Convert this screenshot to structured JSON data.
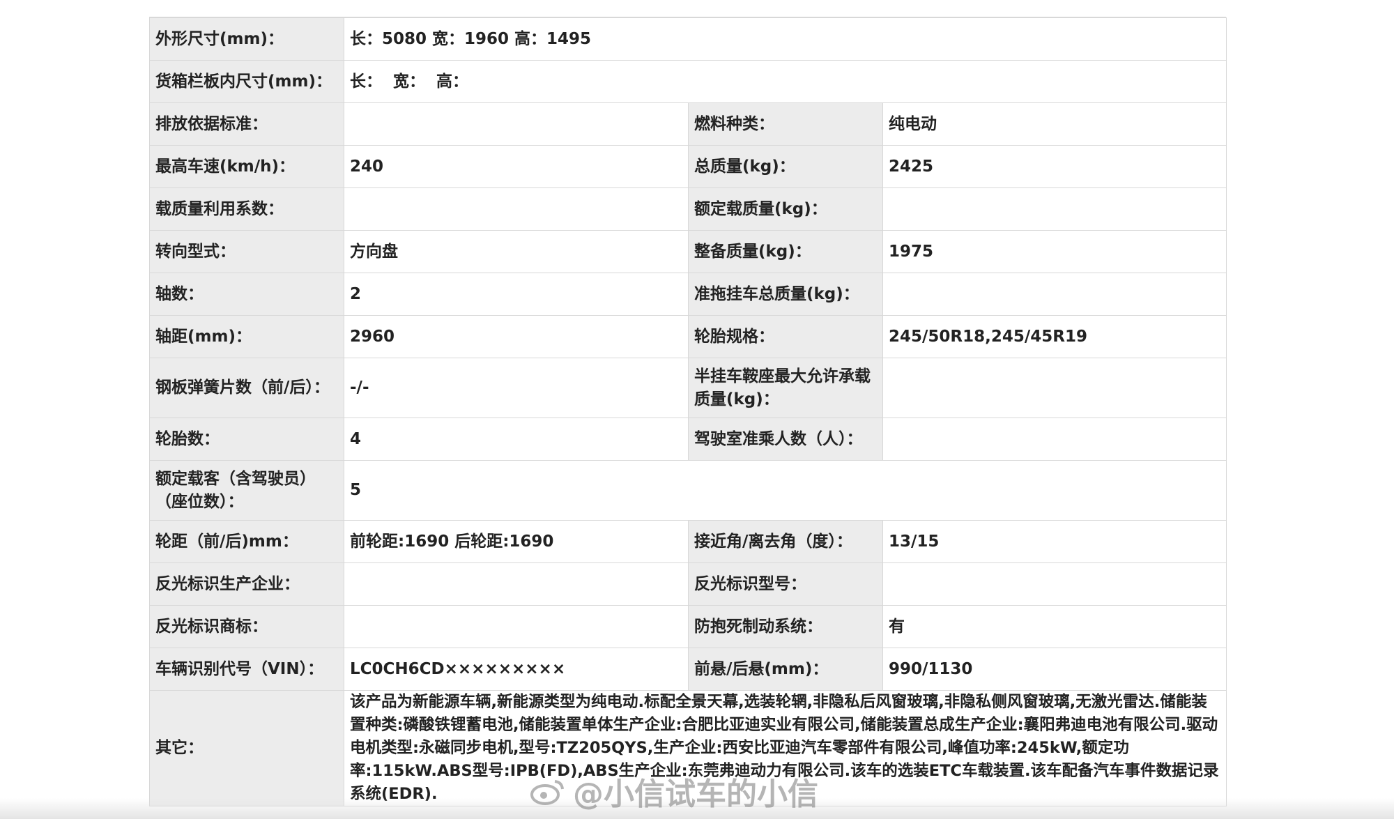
{
  "rows": [
    {
      "l1": "外形尺寸(mm)：",
      "v1": "长：5080 宽：1960 高：1495",
      "full": true
    },
    {
      "l1": "货箱栏板内尺寸(mm)：",
      "v1": "长：  宽：  高：",
      "full": true
    },
    {
      "l1": "排放依据标准：",
      "v1": "",
      "l2": "燃料种类：",
      "v2": "纯电动"
    },
    {
      "l1": "最高车速(km/h)：",
      "v1": "240",
      "l2": "总质量(kg)：",
      "v2": "2425"
    },
    {
      "l1": "载质量利用系数：",
      "v1": "",
      "l2": "额定载质量(kg)：",
      "v2": ""
    },
    {
      "l1": "转向型式：",
      "v1": "方向盘",
      "l2": "整备质量(kg)：",
      "v2": "1975"
    },
    {
      "l1": "轴数：",
      "v1": "2",
      "l2": "准拖挂车总质量(kg)：",
      "v2": ""
    },
    {
      "l1": "轴距(mm)：",
      "v1": "2960",
      "l2": "轮胎规格：",
      "v2": "245/50R18,245/45R19"
    },
    {
      "l1": "钢板弹簧片数（前/后）：",
      "v1": "-/-",
      "l2": "半挂车鞍座最大允许承载质量(kg)：",
      "v2": ""
    },
    {
      "l1": "轮胎数：",
      "v1": "4",
      "l2": "驾驶室准乘人数（人）：",
      "v2": ""
    },
    {
      "l1": "额定载客（含驾驶员）（座位数）：",
      "v1": "5",
      "full": true
    },
    {
      "l1": "轮距（前/后)mm：",
      "v1": "前轮距:1690 后轮距:1690",
      "l2": "接近角/离去角（度）：",
      "v2": "13/15"
    },
    {
      "l1": "反光标识生产企业：",
      "v1": "",
      "l2": "反光标识型号：",
      "v2": ""
    },
    {
      "l1": "反光标识商标：",
      "v1": "",
      "l2": "防抱死制动系统：",
      "v2": "有"
    },
    {
      "l1": "车辆识别代号（VIN）：",
      "v1": "LC0CH6CD×××××××××",
      "l2": "前悬/后悬(mm)：",
      "v2": "990/1130"
    },
    {
      "l1": "其它：",
      "v1": "该产品为新能源车辆,新能源类型为纯电动.标配全景天幕,选装轮辋,非隐私后风窗玻璃,非隐私侧风窗玻璃,无激光雷达.储能装置种类:磷酸铁锂蓄电池,储能装置单体生产企业:合肥比亚迪实业有限公司,储能装置总成生产企业:襄阳弗迪电池有限公司.驱动电机类型:永磁同步电机,型号:TZ205QYS,生产企业:西安比亚迪汽车零部件有限公司,峰值功率:245kW,额定功率:115kW.ABS型号:IPB(FD),ABS生产企业:东莞弗迪动力有限公司.该车的选装ETC车载装置.该车配备汽车事件数据记录系统(EDR).",
      "full": true
    }
  ],
  "watermark": {
    "text": "@小信试车的小信",
    "icon": "weibo-logo-icon"
  }
}
